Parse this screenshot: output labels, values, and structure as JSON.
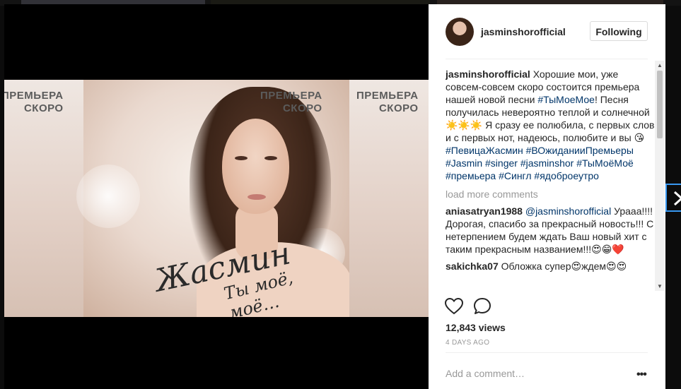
{
  "post": {
    "username": "jasminshorofficial",
    "follow_label": "Following",
    "caption": {
      "author": "jasminshorofficial",
      "text_1": "Хорошие мои, уже совсем-совсем скоро состоится премьера нашей новой песни",
      "tag_1": "#ТыМоеМое",
      "text_2": "! Песня получилась невероятно теплой и солнечной ",
      "emoji_1": "☀️☀️☀️",
      "text_3": " Я сразу ее полюбила, с первых слов и с первых нот, надеюсь, полюбите и вы 😘",
      "tags_2": "#ПевицаЖасмин #ВОжиданииПремьеры #Jasmin #singer #jasminshor #ТыМоёМоё #премьера #Сингл #ядоброеутро"
    },
    "load_more": "load more comments",
    "comments": [
      {
        "author": "aniasatryan1988",
        "mention": "@jasminshorofficial",
        "text": " Урааа!!!! Дорогая, спасибо за прекрасный новость!!! С нетерпением будем ждать Ваш новый хит с таким прекрасным названием!!!😍😁❤️"
      },
      {
        "author": "sakichka07",
        "mention": "",
        "text": " Обложка супер😍ждем😍😍"
      }
    ],
    "views": "12,843 views",
    "time": "4 DAYS AGO",
    "add_comment_placeholder": "Add a comment…",
    "more_label": "•••"
  },
  "artwork": {
    "premiere_line1": "ПРЕМЬЕРА",
    "premiere_line2": "СКОРО",
    "script_name": "Жасмин",
    "script_title": "Ты моё, моё…"
  },
  "icons": {
    "like": "heart-outline-icon",
    "comment": "speech-bubble-icon",
    "next": "chevron-right-icon",
    "more": "ellipsis-icon"
  },
  "colors": {
    "hashtag": "#003569",
    "muted": "#999999",
    "focus_ring": "#3897f0"
  }
}
